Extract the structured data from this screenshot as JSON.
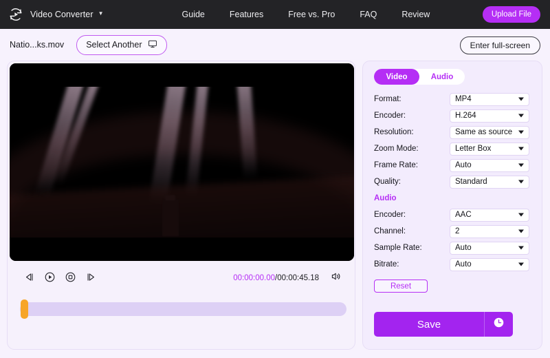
{
  "header": {
    "logo_icon": "convert-play-circle-icon",
    "brand": "Video Converter",
    "brand_caret": "▼",
    "nav": [
      {
        "label": "Guide"
      },
      {
        "label": "Features"
      },
      {
        "label": "Free vs. Pro"
      },
      {
        "label": "FAQ"
      },
      {
        "label": "Review"
      }
    ],
    "upload_label": "Upload File",
    "accent": "#b52ef5",
    "background": "#232326"
  },
  "filebar": {
    "filename": "Natio...ks.mov",
    "select_another_label": "Select Another",
    "select_another_icon": "monitor-icon",
    "fullscreen_label": "Enter full-screen"
  },
  "player": {
    "controls": [
      {
        "name": "previous-frame-button",
        "icon": "previous-frame-icon"
      },
      {
        "name": "play-button",
        "icon": "play-circle-icon"
      },
      {
        "name": "stop-button",
        "icon": "stop-circle-icon"
      },
      {
        "name": "next-frame-button",
        "icon": "next-frame-icon"
      }
    ],
    "current_time": "00:00:00.00",
    "total_time": "/00:00:45.18",
    "volume_icon": "speaker-icon",
    "current_time_color": "#b52ef5",
    "trim_handle_color": "#f7a528",
    "trim_track_color": "#ddd0f5"
  },
  "settings": {
    "tabs": [
      {
        "label": "Video",
        "active": true
      },
      {
        "label": "Audio",
        "active": false
      }
    ],
    "video_rows": [
      {
        "label": "Format:",
        "value": "MP4"
      },
      {
        "label": "Encoder:",
        "value": "H.264"
      },
      {
        "label": "Resolution:",
        "value": "Same as source"
      },
      {
        "label": "Zoom Mode:",
        "value": "Letter Box"
      },
      {
        "label": "Frame Rate:",
        "value": "Auto"
      },
      {
        "label": "Quality:",
        "value": "Standard"
      }
    ],
    "audio_section_label": "Audio",
    "audio_rows": [
      {
        "label": "Encoder:",
        "value": "AAC"
      },
      {
        "label": "Channel:",
        "value": "2"
      },
      {
        "label": "Sample Rate:",
        "value": "Auto"
      },
      {
        "label": "Bitrate:",
        "value": "Auto"
      }
    ],
    "reset_label": "Reset",
    "save_label": "Save",
    "save_history_icon": "clock-icon"
  }
}
